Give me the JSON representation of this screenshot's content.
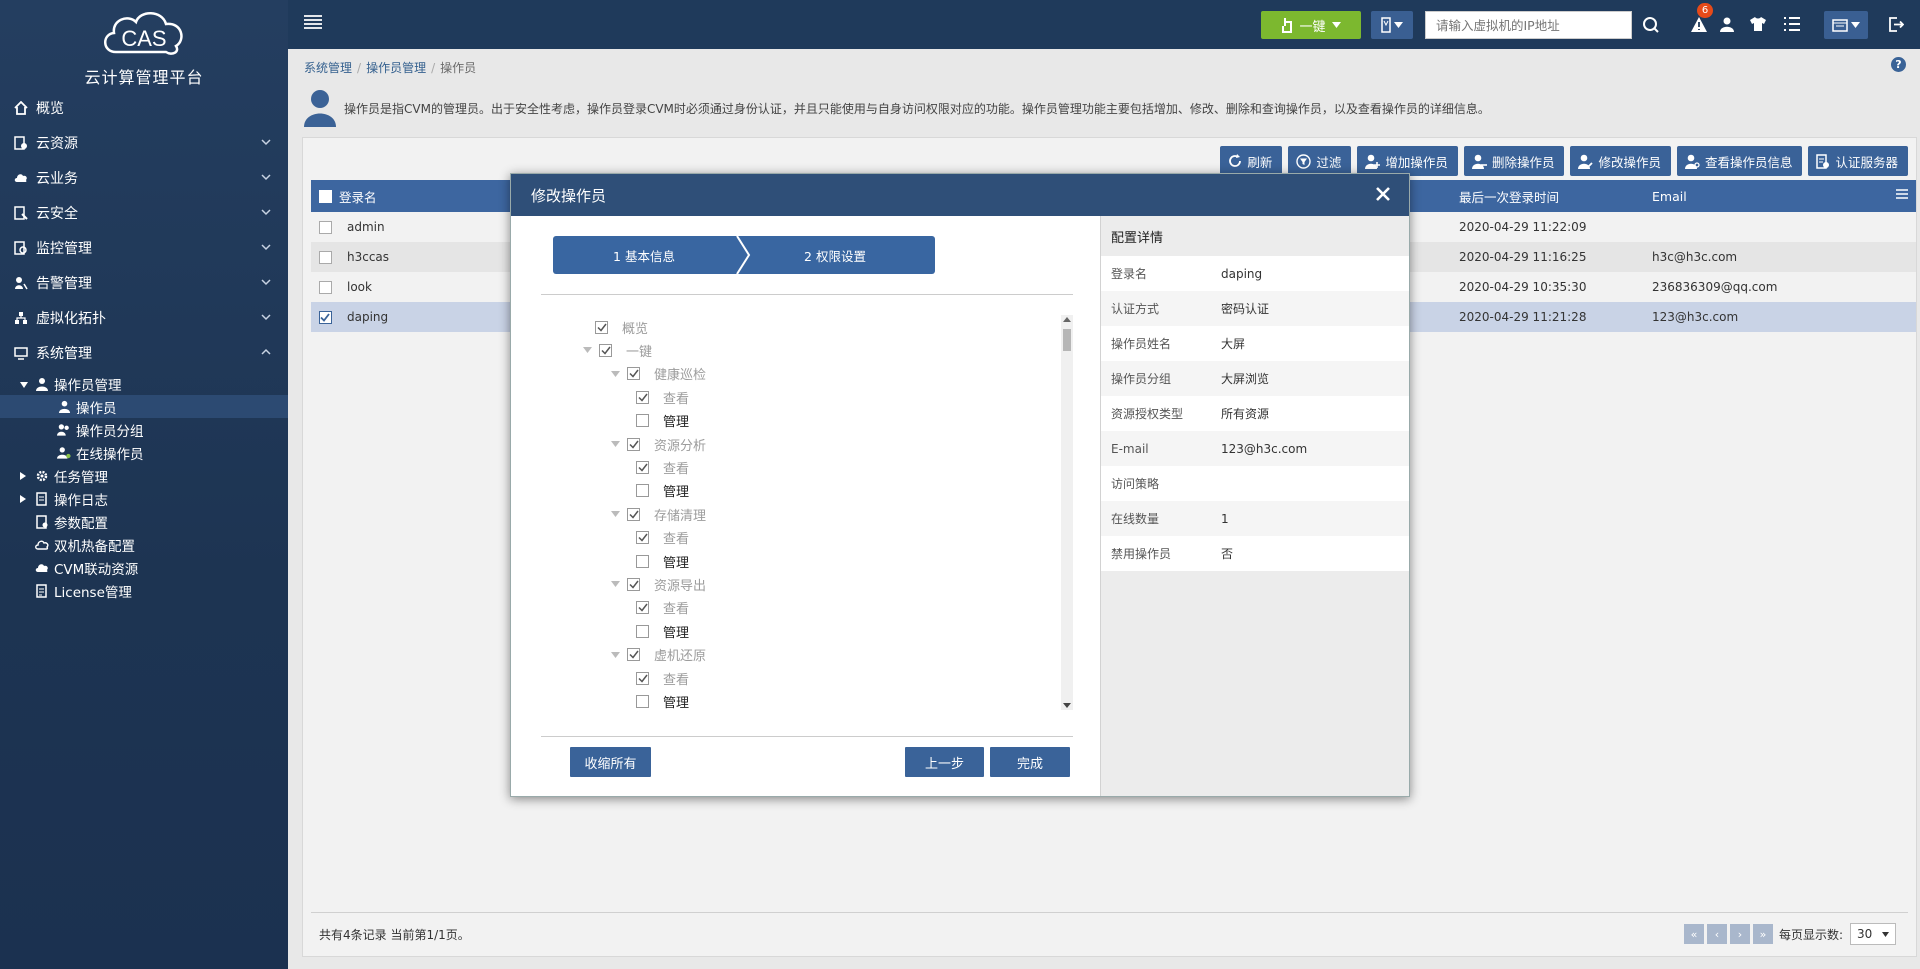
{
  "brand": {
    "logo_text": "CAS",
    "title": "云计算管理平台"
  },
  "sidebar": {
    "items": [
      {
        "label": "概览",
        "icon": "home-icon",
        "expandable": false
      },
      {
        "label": "云资源",
        "icon": "resources-icon",
        "expandable": true
      },
      {
        "label": "云业务",
        "icon": "cloud-icon",
        "expandable": true
      },
      {
        "label": "云安全",
        "icon": "security-icon",
        "expandable": true
      },
      {
        "label": "监控管理",
        "icon": "monitor-icon",
        "expandable": true
      },
      {
        "label": "告警管理",
        "icon": "alarm-icon",
        "expandable": true
      },
      {
        "label": "虚拟化拓扑",
        "icon": "topology-icon",
        "expandable": true
      },
      {
        "label": "系统管理",
        "icon": "system-icon",
        "expandable": true
      }
    ],
    "system_sub": {
      "operator_mgmt": "操作员管理",
      "operator": "操作员",
      "operator_group": "操作员分组",
      "online_operator": "在线操作员",
      "task_mgmt": "任务管理",
      "op_log": "操作日志",
      "param_config": "参数配置",
      "hot_standby": "双机热备配置",
      "cvm_linkage": "CVM联动资源",
      "license": "License管理"
    }
  },
  "topbar": {
    "onekey_label": "一键",
    "search_placeholder": "请输入虚拟机的IP地址",
    "alert_count": "6"
  },
  "breadcrumb": [
    "系统管理",
    "操作员管理",
    "操作员"
  ],
  "description": "操作员是指CVM的管理员。出于安全性考虑，操作员登录CVM时必须通过身份认证，并且只能使用与自身访问权限对应的功能。操作员管理功能主要包括增加、修改、删除和查询操作员，以及查看操作员的详细信息。",
  "toolbar": {
    "refresh": "刷新",
    "filter": "过滤",
    "add": "增加操作员",
    "delete": "删除操作员",
    "edit": "修改操作员",
    "view": "查看操作员信息",
    "auth": "认证服务器"
  },
  "grid": {
    "headers": {
      "name": "登录名",
      "last_login": "最后一次登录时间",
      "email": "Email"
    },
    "rows": [
      {
        "name": "admin",
        "last_login": "2020-04-29 11:22:09",
        "email": "",
        "checked": false
      },
      {
        "name": "h3ccas",
        "last_login": "2020-04-29 11:16:25",
        "email": "h3c@h3c.com",
        "checked": false
      },
      {
        "name": "look",
        "last_login": "2020-04-29 10:35:30",
        "email": "236836309@qq.com",
        "checked": false
      },
      {
        "name": "daping",
        "last_login": "2020-04-29 11:21:28",
        "email": "123@h3c.com",
        "checked": true
      }
    ]
  },
  "footer": {
    "summary": "共有4条记录 当前第1/1页。",
    "per_page_label": "每页显示数:",
    "per_page_value": "30"
  },
  "dialog": {
    "title": "修改操作员",
    "steps": [
      "1 基本信息",
      "2 权限设置"
    ],
    "tree": [
      {
        "label": "概览",
        "level": 0,
        "checked": true,
        "expander": false,
        "style": "grey"
      },
      {
        "label": "一键",
        "level": 0,
        "checked": true,
        "expander": true,
        "style": "grey"
      },
      {
        "label": "健康巡检",
        "level": 1,
        "checked": true,
        "expander": true,
        "style": "grey"
      },
      {
        "label": "查看",
        "level": 2,
        "checked": true,
        "expander": false,
        "style": "grey"
      },
      {
        "label": "管理",
        "level": 2,
        "checked": false,
        "expander": false,
        "style": "dark"
      },
      {
        "label": "资源分析",
        "level": 1,
        "checked": true,
        "expander": true,
        "style": "grey"
      },
      {
        "label": "查看",
        "level": 2,
        "checked": true,
        "expander": false,
        "style": "grey"
      },
      {
        "label": "管理",
        "level": 2,
        "checked": false,
        "expander": false,
        "style": "dark"
      },
      {
        "label": "存储清理",
        "level": 1,
        "checked": true,
        "expander": true,
        "style": "grey"
      },
      {
        "label": "查看",
        "level": 2,
        "checked": true,
        "expander": false,
        "style": "grey"
      },
      {
        "label": "管理",
        "level": 2,
        "checked": false,
        "expander": false,
        "style": "dark"
      },
      {
        "label": "资源导出",
        "level": 1,
        "checked": true,
        "expander": true,
        "style": "grey"
      },
      {
        "label": "查看",
        "level": 2,
        "checked": true,
        "expander": false,
        "style": "grey"
      },
      {
        "label": "管理",
        "level": 2,
        "checked": false,
        "expander": false,
        "style": "dark"
      },
      {
        "label": "虚机还原",
        "level": 1,
        "checked": true,
        "expander": true,
        "style": "grey"
      },
      {
        "label": "查看",
        "level": 2,
        "checked": true,
        "expander": false,
        "style": "grey"
      },
      {
        "label": "管理",
        "level": 2,
        "checked": false,
        "expander": false,
        "style": "dark"
      }
    ],
    "collapse_all": "收缩所有",
    "prev": "上一步",
    "finish": "完成",
    "detail": {
      "title": "配置详情",
      "rows": [
        {
          "k": "登录名",
          "v": "daping"
        },
        {
          "k": "认证方式",
          "v": "密码认证"
        },
        {
          "k": "操作员姓名",
          "v": "大屏"
        },
        {
          "k": "操作员分组",
          "v": "大屏浏览"
        },
        {
          "k": "资源授权类型",
          "v": "所有资源"
        },
        {
          "k": "E-mail",
          "v": "123@h3c.com"
        },
        {
          "k": "访问策略",
          "v": ""
        },
        {
          "k": "在线数量",
          "v": "1"
        },
        {
          "k": "禁用操作员",
          "v": "否"
        }
      ]
    }
  }
}
